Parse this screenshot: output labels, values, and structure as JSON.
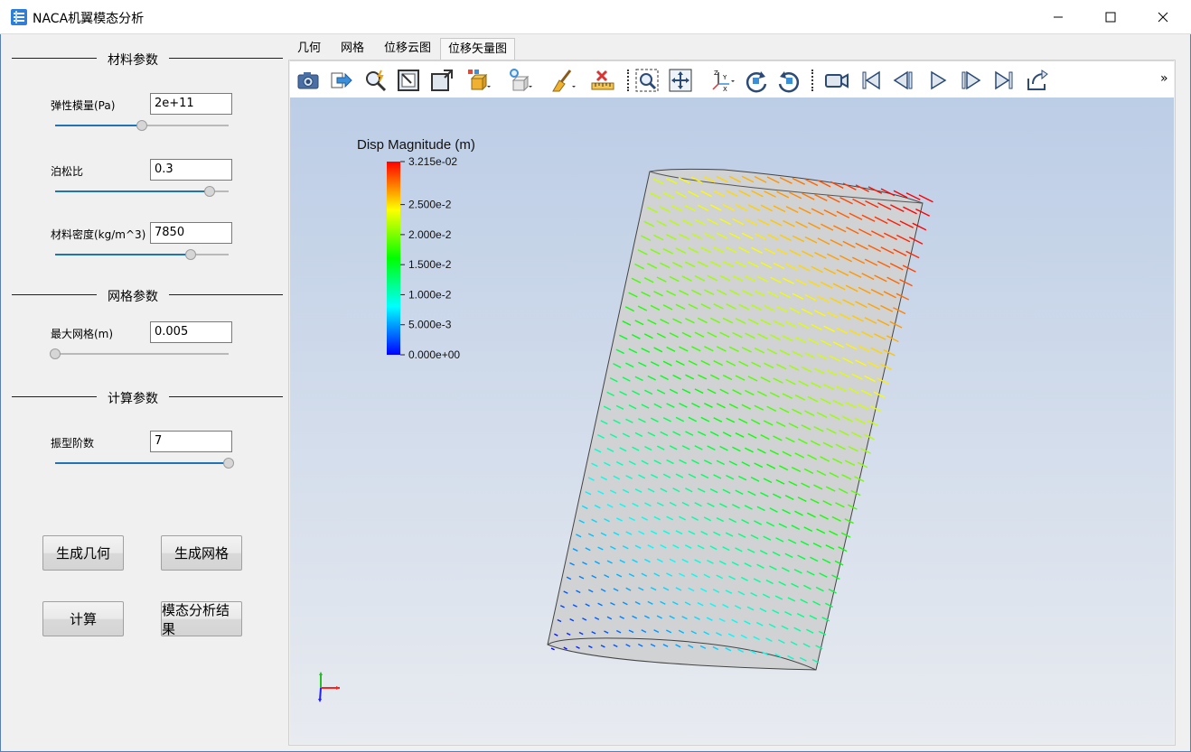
{
  "window": {
    "title": "NACA机翼模态分析",
    "controls": {
      "minimize": "—",
      "maximize": "☐",
      "close": "✕"
    }
  },
  "groups": {
    "material": "材料参数",
    "mesh": "网格参数",
    "compute": "计算参数"
  },
  "params": {
    "youngs_modulus": {
      "label": "弹性模量(Pa)",
      "value": "2e+11",
      "slider": 0.5
    },
    "poisson_ratio": {
      "label": "泊松比",
      "value": "0.3",
      "slider": 0.89
    },
    "density": {
      "label": "材料密度(kg/m^3)",
      "value": "7850",
      "slider": 0.78
    },
    "max_mesh": {
      "label": "最大网格(m)",
      "value": "0.005",
      "slider": 0.0
    },
    "mode_count": {
      "label": "振型阶数",
      "value": "7",
      "slider": 1.0
    }
  },
  "buttons": {
    "gen_geometry": "生成几何",
    "gen_mesh": "生成网格",
    "compute": "计算",
    "modal_results": "模态分析结果"
  },
  "tabs": [
    {
      "label": "几何",
      "active": false
    },
    {
      "label": "网格",
      "active": false
    },
    {
      "label": "位移云图",
      "active": false
    },
    {
      "label": "位移矢量图",
      "active": true
    }
  ],
  "toolbar": {
    "tools": [
      "camera-icon",
      "export-icon",
      "zoom-icon",
      "reset-view-icon",
      "fit-view-icon",
      "display-mode-icon",
      "representation-icon",
      "light-icon",
      "clear-icon",
      "ruler-icon",
      "zoom-box-icon",
      "center-icon",
      "axes-icon",
      "rotate-cw-icon",
      "rotate-ccw-icon",
      "video-icon",
      "first-frame-icon",
      "prev-frame-icon",
      "play-icon",
      "next-frame-icon",
      "last-frame-icon",
      "loop-icon"
    ],
    "overflow": "»"
  },
  "viewport": {
    "legend": {
      "title": "Disp Magnitude (m)",
      "labels": [
        "3.215e-02",
        "2.500e-2",
        "2.000e-2",
        "1.500e-2",
        "1.000e-2",
        "5.000e-3",
        "0.000e+00"
      ],
      "values": [
        0.03215,
        0.025,
        0.02,
        0.015,
        0.01,
        0.005,
        0.0
      ],
      "colors": [
        "#ff0000",
        "#ffff00",
        "#00ff00",
        "#00ffff",
        "#0000ff"
      ]
    },
    "axes": {
      "x_color": "#ff2020",
      "y_color": "#20c020",
      "z_color": "#2020ff"
    }
  }
}
